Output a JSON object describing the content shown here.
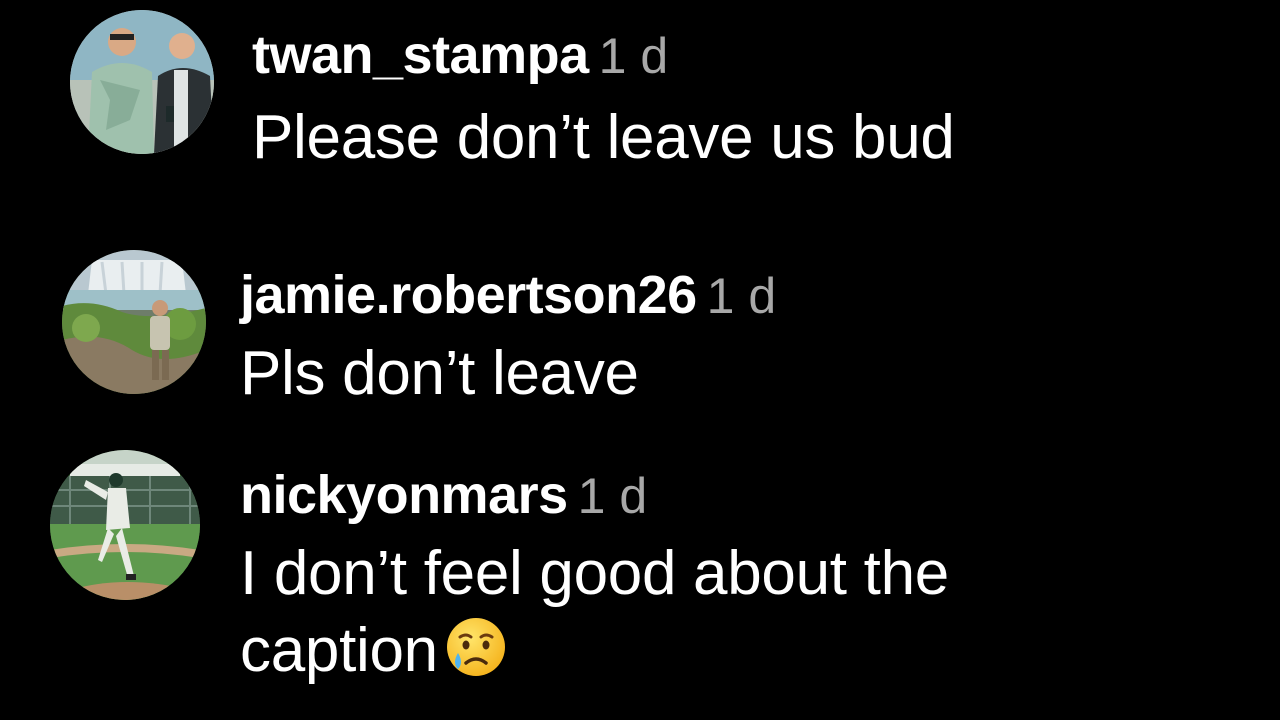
{
  "comments": [
    {
      "username": "twan_stampa",
      "time": "1 d",
      "text": "Please don’t leave us bud",
      "avatar": "avatar-two-men-photo"
    },
    {
      "username": "jamie.robertson26",
      "time": "1 d",
      "text": "Pls don’t leave",
      "avatar": "avatar-waterfall-photo"
    },
    {
      "username": "nickyonmars",
      "time": "1 d",
      "text_line1": "I don’t feel good about the",
      "text_line2": "caption",
      "emoji": "crying-face-emoji",
      "avatar": "avatar-baseball-pitcher-photo"
    }
  ],
  "colors": {
    "background": "#000000",
    "username": "#ffffff",
    "timestamp": "#a8a8a8",
    "text": "#ffffff"
  }
}
